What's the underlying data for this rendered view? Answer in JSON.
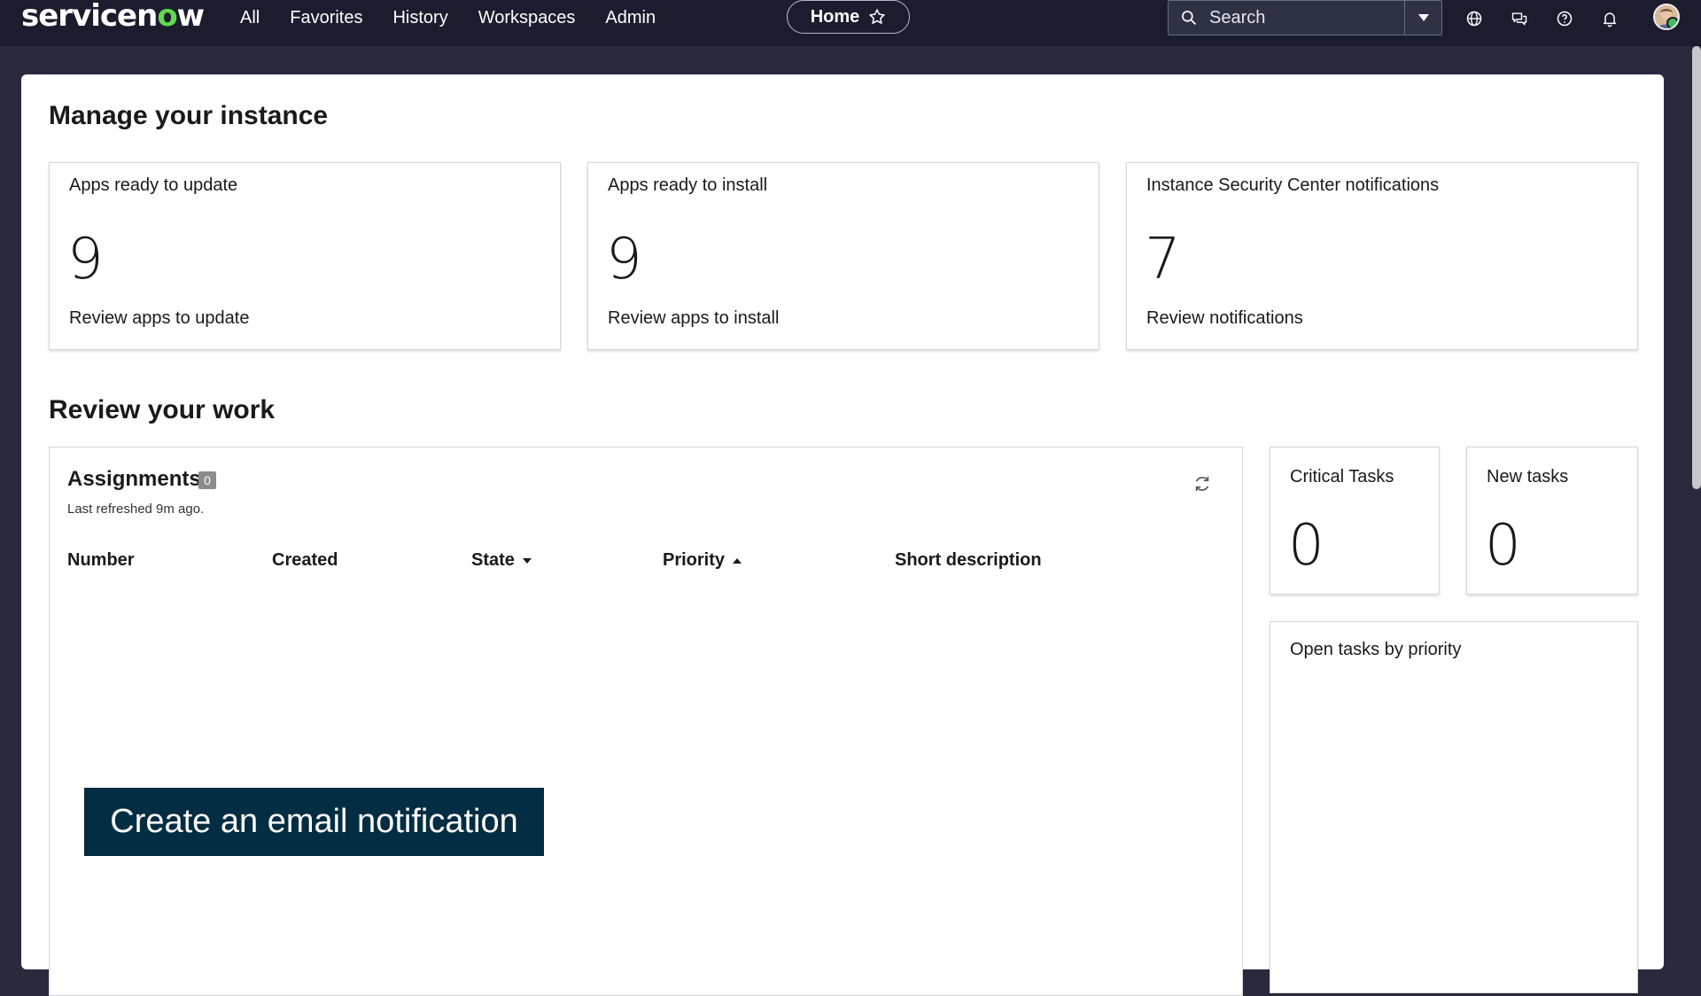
{
  "topbar": {
    "logo": {
      "text_main": "servicen",
      "text_o": "o",
      "text_end": "w"
    },
    "nav": [
      "All",
      "Favorites",
      "History",
      "Workspaces",
      "Admin"
    ],
    "home_label": "Home",
    "search_placeholder": "Search"
  },
  "instance": {
    "heading": "Manage your instance",
    "cards": [
      {
        "title": "Apps ready to update",
        "value": "9",
        "link": "Review apps to update"
      },
      {
        "title": "Apps ready to install",
        "value": "9",
        "link": "Review apps to install"
      },
      {
        "title": "Instance Security Center notifications",
        "value": "7",
        "link": "Review notifications"
      }
    ]
  },
  "work": {
    "heading": "Review your work",
    "assignments": {
      "title": "Assignments",
      "count": "0",
      "refreshed": "Last refreshed 9m ago.",
      "columns": [
        "Number",
        "Created",
        "State",
        "Priority",
        "Short description"
      ]
    },
    "critical": {
      "title": "Critical Tasks",
      "value": "0"
    },
    "new_tasks": {
      "title": "New tasks",
      "value": "0"
    },
    "open_by_priority": {
      "title": "Open tasks by priority"
    }
  },
  "overlay": {
    "caption": "Create an email notification"
  },
  "colors": {
    "topbar": "#1b1c2e",
    "accent_green": "#62d84e",
    "caption_bg": "#032d42"
  }
}
